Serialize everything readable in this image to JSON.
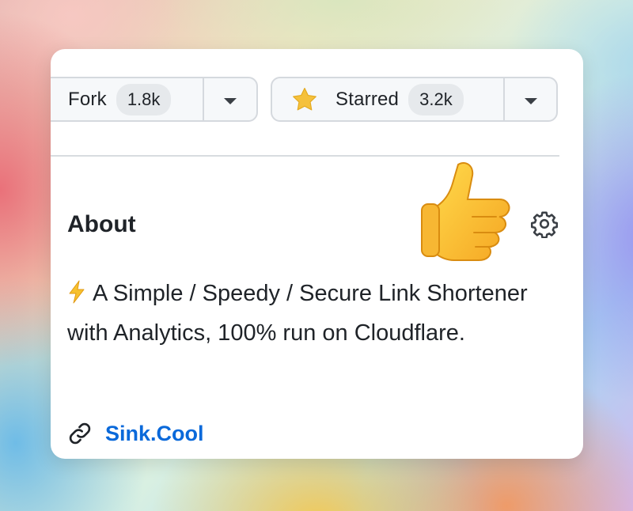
{
  "repo_actions": {
    "fork": {
      "label": "Fork",
      "count": "1.8k"
    },
    "star": {
      "label": "Starred",
      "count": "3.2k"
    }
  },
  "about": {
    "title": "About",
    "description": "A Simple / Speedy / Secure Link Shortener with Analytics, 100% run on Cloudflare.",
    "website": "Sink.Cool"
  },
  "icons": {
    "star": "star-icon",
    "settings": "gear-icon",
    "description_prefix": "lightning-bolt-icon",
    "link": "link-icon",
    "reaction": "thumbs-up-icon"
  },
  "colors": {
    "link": "#0a69da",
    "star": "#f5c13c",
    "counter_bg": "#e6e9ec"
  }
}
